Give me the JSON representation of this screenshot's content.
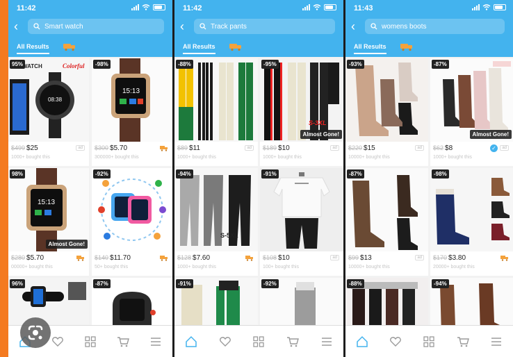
{
  "colors": {
    "header": "#43b3ee",
    "accent_strip": "#f47a20",
    "badge": "#222222",
    "icon_gray": "#9a9a9a"
  },
  "screens": [
    {
      "time": "11:42",
      "search_query": "Smart watch",
      "tab_label": "All Results",
      "products": [
        {
          "discount": "95%",
          "orig_price": "$499",
          "price": "$25",
          "bought": "1000+ bought this",
          "tag": "ad"
        },
        {
          "discount": "-98%",
          "orig_price": "$300",
          "price": "$5.70",
          "bought": "300000+ bought this",
          "tag": "truck"
        },
        {
          "discount": "98%",
          "orig_price": "$280",
          "price": "$5.70",
          "bought": "00000+ bought this",
          "tag": "truck",
          "almost_gone": "Almost Gone!"
        },
        {
          "discount": "-92%",
          "orig_price": "$140",
          "price": "$11.70",
          "bought": "50+ bought this",
          "tag": "truck"
        },
        {
          "discount": "96%"
        },
        {
          "discount": "-87%"
        }
      ]
    },
    {
      "time": "11:42",
      "search_query": "Track pants",
      "tab_label": "All Results",
      "products": [
        {
          "discount": "-88%",
          "orig_price": "$89",
          "price": "$11",
          "bought": "1000+ bought this",
          "tag": "ad"
        },
        {
          "discount": "-95%",
          "orig_price": "$189",
          "price": "$10",
          "bought": "1000+ bought this",
          "tag": "ad",
          "almost_gone": "Almost Gone!",
          "img_text": "S-3XL"
        },
        {
          "discount": "-94%",
          "orig_price": "$128",
          "price": "$7.60",
          "bought": "1000+ bought this",
          "tag": "truck",
          "img_text": "S-5XL"
        },
        {
          "discount": "-91%",
          "orig_price": "$108",
          "price": "$10",
          "bought": "100+ bought this",
          "tag": "ad"
        },
        {
          "discount": "-91%"
        },
        {
          "discount": "-92%"
        }
      ]
    },
    {
      "time": "11:43",
      "search_query": "womens boots",
      "tab_label": "All Results",
      "products": [
        {
          "discount": "-93%",
          "orig_price": "$220",
          "price": "$15",
          "bought": "10000+ bought this",
          "tag": "ad"
        },
        {
          "discount": "-87%",
          "orig_price": "$62",
          "price": "$8",
          "bought": "1000+ bought this",
          "tag": "ad",
          "almost_gone": "Almost Gone!",
          "verified": "✓"
        },
        {
          "discount": "-87%",
          "orig_price": "$99",
          "price": "$13",
          "bought": "10000+ bought this",
          "tag": "ad"
        },
        {
          "discount": "-98%",
          "orig_price": "$170",
          "price": "$3.80",
          "bought": "20000+ bought this",
          "tag": "truck"
        },
        {
          "discount": "-88%"
        },
        {
          "discount": "-94%"
        }
      ]
    }
  ],
  "ad_label": "ad",
  "bottom_nav": [
    "home-icon",
    "heart-icon",
    "grid-icon",
    "cart-icon",
    "menu-icon"
  ]
}
